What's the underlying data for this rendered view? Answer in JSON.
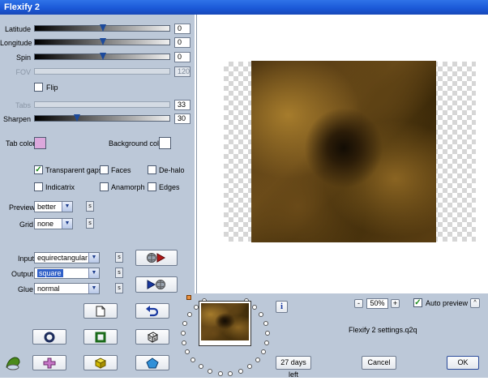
{
  "window": {
    "title": "Flexify 2"
  },
  "sliders": {
    "latitude": {
      "label": "Latitude",
      "value": "0"
    },
    "longitude": {
      "label": "Longitude",
      "value": "0"
    },
    "spin": {
      "label": "Spin",
      "value": "0"
    },
    "fov": {
      "label": "FOV",
      "value": "120"
    },
    "tabs": {
      "label": "Tabs",
      "value": "33"
    },
    "sharpen": {
      "label": "Sharpen",
      "value": "30"
    }
  },
  "flip": {
    "label": "Flip",
    "checked": false
  },
  "colors": {
    "tab_color_label": "Tab color",
    "tab_color": "#dca8dc",
    "background_color_label": "Background color",
    "background_color": "#ffffff"
  },
  "options": {
    "transparent_gaps": {
      "label": "Transparent gaps",
      "checked": true
    },
    "faces": {
      "label": "Faces",
      "checked": false
    },
    "de_halo": {
      "label": "De-halo",
      "checked": false
    },
    "indicatrix": {
      "label": "Indicatrix",
      "checked": false
    },
    "anamorph": {
      "label": "Anamorph",
      "checked": false
    },
    "edges": {
      "label": "Edges",
      "checked": false
    }
  },
  "preview_select": {
    "label": "Preview",
    "value": "better"
  },
  "grid_select": {
    "label": "Grid",
    "value": "none"
  },
  "input_select": {
    "label": "Input",
    "value": "equirectangular"
  },
  "output_select": {
    "label": "Output",
    "value": "square"
  },
  "glue_select": {
    "label": "Glue",
    "value": "normal"
  },
  "small_button": "s",
  "zoom": {
    "minus": "-",
    "value": "50%",
    "plus": "+"
  },
  "auto_preview": {
    "label": "Auto preview",
    "checked": true
  },
  "info_button": "i",
  "settings_file": "Flexify 2 settings.q2q",
  "trial": "27 days left",
  "cancel": "Cancel",
  "ok": "OK",
  "up_button": "^",
  "theme": {
    "accent": "#1a57d6",
    "panel": "#bcc8d8",
    "texture": "#5a3e12"
  }
}
